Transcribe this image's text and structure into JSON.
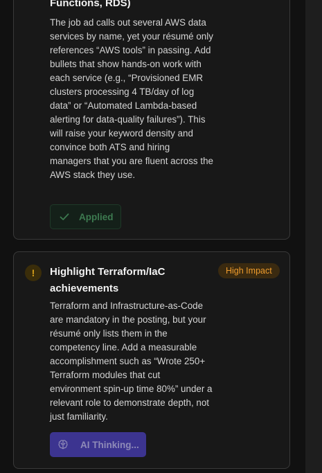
{
  "cards": [
    {
      "title": "Functions, RDS)",
      "body": "The job ad calls out several AWS data services by name, yet your résumé only references “AWS tools” in passing. Add bullets that show hands-on work with each service (e.g., “Provisioned EMR clusters processing 4 TB/day of log data” or “Automated Lambda-based alerting for data-quality failures”). This will raise your keyword density and convince both ATS and hiring managers that you are fluent across the AWS stack they use.",
      "status_button": {
        "label": "Applied",
        "icon": "check-icon"
      }
    },
    {
      "icon": "warning-icon",
      "icon_glyph": "!",
      "title": "Highlight Terraform/IaC achievements",
      "badge": "High Impact",
      "body": "Terraform and Infrastructure-as-Code are mandatory in the posting, but your résumé only lists them in the competency line. Add a measurable accomplishment such as “Wrote 250+ Terraform modules that cut environment spin-up time 80%” under a relevant role to demonstrate depth, not just familiarity.",
      "action_button": {
        "label": "AI Thinking...",
        "icon": "brain-icon"
      }
    }
  ],
  "colors": {
    "background": "#111111",
    "card": "#181818",
    "applied_text": "#3d7a50",
    "warning": "#d9a21b",
    "badge_text": "#ef9c2d",
    "ai_button": "#3c3490"
  }
}
